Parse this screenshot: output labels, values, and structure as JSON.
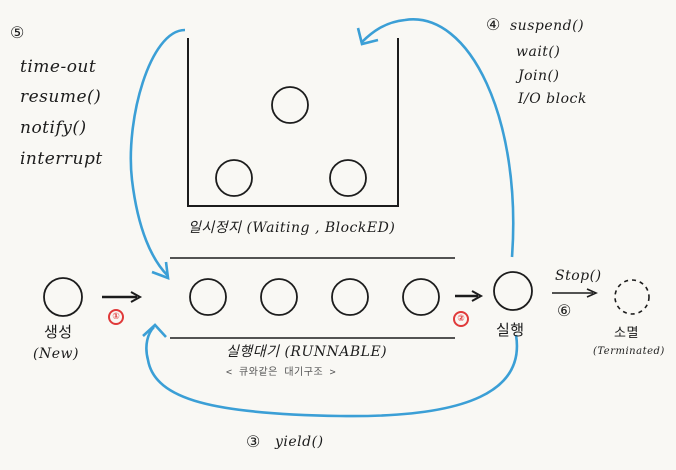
{
  "labels": {
    "create": "생성",
    "create_en": "(New)",
    "running": "실행",
    "terminated": "소멸",
    "terminated_en": "(Terminated)",
    "waiting": "일시정지 (Waiting , BlockED)",
    "runnable": "실행대기 (RUNNABLE)",
    "runnable_note": "< 큐와같은 대기구조 >"
  },
  "transitions": {
    "step1": "①",
    "step2": "②",
    "step3_num": "③",
    "step3_label": "yield()",
    "step4_num": "④",
    "step4_items": [
      "suspend()",
      "wait()",
      "Join()",
      "I/O block"
    ],
    "step5_num": "⑤",
    "step5_items": [
      "time-out",
      "resume()",
      "notify()",
      "interrupt"
    ],
    "step6_num": "⑥",
    "step6_label": "Stop()"
  },
  "colors": {
    "line": "#3b9fd6",
    "stroke": "#1c1c1c",
    "accent": "#e03a3a"
  }
}
